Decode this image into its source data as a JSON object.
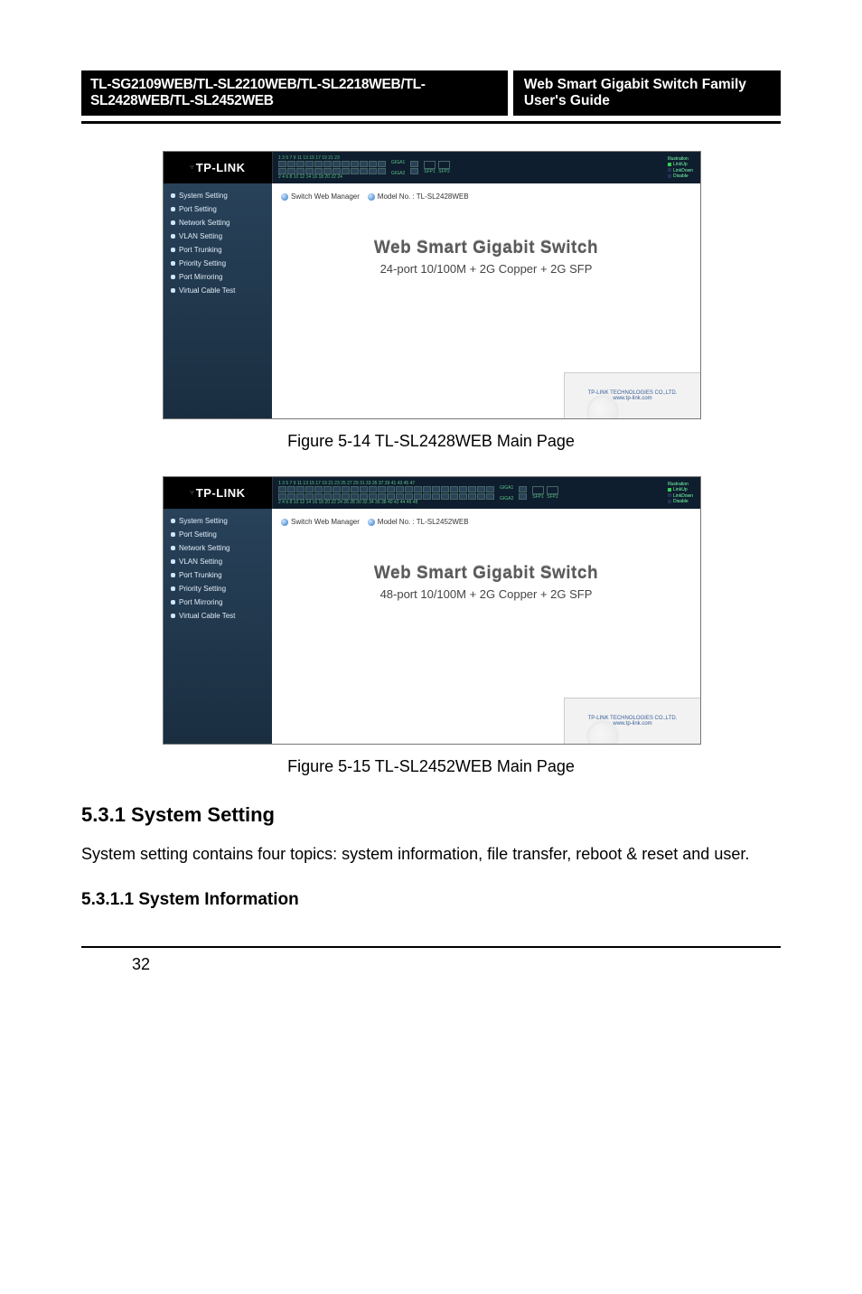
{
  "header": {
    "left": "TL-SG2109WEB/TL-SL2210WEB/TL-SL2218WEB/TL-SL2428WEB/TL-SL2452WEB",
    "right": "Web Smart Gigabit Switch Family User's Guide"
  },
  "figure1": {
    "caption": "Figure 5-14  TL-SL2428WEB Main Page",
    "logo": "TP-LINK",
    "crumb_label": "Switch Web Manager",
    "crumb_model": "Model No. : TL-SL2428WEB",
    "hero_title": "Web Smart Gigabit Switch",
    "hero_sub": "24-port 10/100M + 2G Copper + 2G SFP",
    "illus_title": "Illustration",
    "illus_linkup": "LinkUp",
    "illus_linkdown": "LinkDown",
    "illus_disable": "Disable",
    "port_top_labels": "1 3 5 7 9 11 13 15 17 19 21 23",
    "port_bot_labels": "2 4 6 8 10 12 14 16 18 20 22 24",
    "ge_label_1": "GIGA1",
    "ge_label_2": "GIGA2",
    "sfp_label_1": "SFP1",
    "sfp_label_2": "SFP2",
    "footer_company": "TP-LINK TECHNOLOGIES CO.,LTD.",
    "footer_url": "www.tp-link.com"
  },
  "figure2": {
    "caption": "Figure 5-15  TL-SL2452WEB Main Page",
    "logo": "TP-LINK",
    "crumb_label": "Switch Web Manager",
    "crumb_model": "Model No. : TL-SL2452WEB",
    "hero_title": "Web Smart Gigabit Switch",
    "hero_sub": "48-port 10/100M + 2G Copper + 2G SFP",
    "illus_title": "Illustration",
    "illus_linkup": "LinkUp",
    "illus_linkdown": "LinkDown",
    "illus_disable": "Disable",
    "port_top_labels": "1 3 5 7 9 11 13 15 17 19 21 23 25 27 29 31 33 35 37 39 41 43 45 47",
    "port_bot_labels": "2 4 6 8 10 12 14 16 18 20 22 24 26 28 30 32 34 36 38 40 42 44 46 48",
    "ge_label_1": "GIGA1",
    "ge_label_2": "GIGA2",
    "sfp_label_1": "SFP1",
    "sfp_label_2": "SFP2",
    "footer_company": "TP-LINK TECHNOLOGIES CO.,LTD.",
    "footer_url": "www.tp-link.com"
  },
  "nav_items": [
    "System Setting",
    "Port Setting",
    "Network Setting",
    "VLAN Setting",
    "Port Trunking",
    "Priority Setting",
    "Port Mirroring",
    "Virtual Cable Test"
  ],
  "section": {
    "num_title": "5.3.1  System Setting",
    "para": "System setting contains four topics: system information, file transfer, reboot & reset and user.",
    "sub": "5.3.1.1 System Information"
  },
  "page_number": "32"
}
